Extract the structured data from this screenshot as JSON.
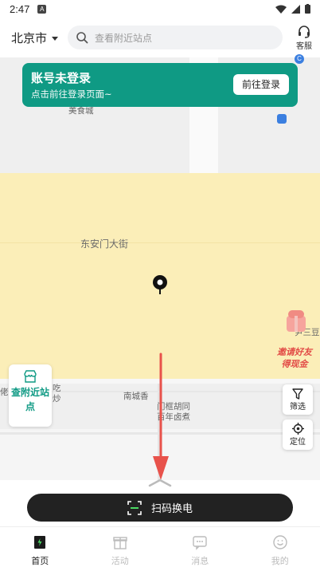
{
  "status_bar": {
    "time": "2:47",
    "notification_letter": "A"
  },
  "header": {
    "city": "北京市",
    "search_placeholder": "查看附近站点",
    "service_label": "客服"
  },
  "login_banner": {
    "title": "账号未登录",
    "subtitle": "点击前往登录页面~",
    "button_label": "前往登录"
  },
  "map": {
    "labels": {
      "food_city": "美食城",
      "street": "东安门大街",
      "south_pool": "南城香",
      "hutong_1": "门框胡同",
      "hutong_2": "百年卤煮",
      "left_1": "吃",
      "left_2": "炒",
      "left_3": "佬",
      "shop_right": "尹三豆"
    },
    "nearby_card_label": "查附近站点",
    "filter_label": "筛选",
    "locate_label": "定位",
    "invite_line1": "邀请好友",
    "invite_line2": "得现金"
  },
  "scan_button_label": "扫码换电",
  "tabs": [
    {
      "label": "首页",
      "icon": "home-icon",
      "active": true
    },
    {
      "label": "活动",
      "icon": "gift-icon",
      "active": false
    },
    {
      "label": "消息",
      "icon": "message-icon",
      "active": false
    },
    {
      "label": "我的",
      "icon": "profile-icon",
      "active": false
    }
  ],
  "colors": {
    "brand": "#0f9a84",
    "dark": "#222222",
    "arrow": "#e8524b",
    "map_yellow": "#fbeeb8"
  }
}
